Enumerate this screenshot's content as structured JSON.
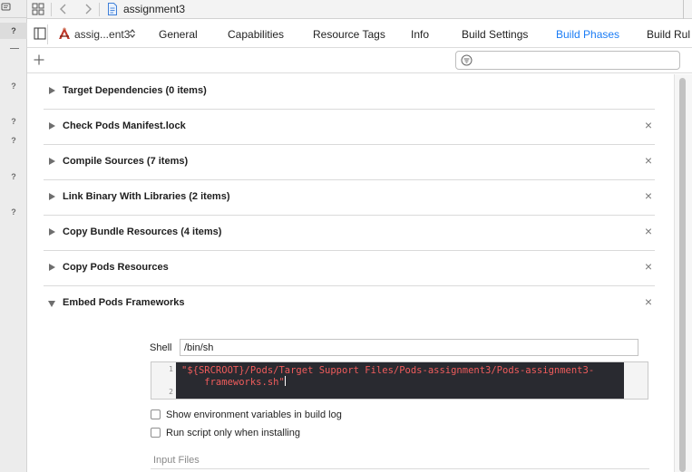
{
  "window": {
    "title": "assignment3"
  },
  "gutter": {
    "markers": [
      "?",
      "?",
      "?",
      "?",
      "?",
      "?"
    ]
  },
  "tabbar": {
    "target_name": "assig...ent3",
    "tabs": [
      {
        "label": "General",
        "active": false
      },
      {
        "label": "Capabilities",
        "active": false
      },
      {
        "label": "Resource Tags",
        "active": false
      },
      {
        "label": "Info",
        "active": false
      },
      {
        "label": "Build Settings",
        "active": false
      },
      {
        "label": "Build Phases",
        "active": true
      },
      {
        "label": "Build Rul",
        "active": false
      }
    ]
  },
  "filter": {
    "placeholder": ""
  },
  "phases": [
    {
      "label": "Target Dependencies (0 items)",
      "closable": false,
      "expanded": false
    },
    {
      "label": "Check Pods Manifest.lock",
      "closable": true,
      "expanded": false
    },
    {
      "label": "Compile Sources (7 items)",
      "closable": true,
      "expanded": false
    },
    {
      "label": "Link Binary With Libraries (2 items)",
      "closable": true,
      "expanded": false
    },
    {
      "label": "Copy Bundle Resources (4 items)",
      "closable": true,
      "expanded": false
    },
    {
      "label": "Copy Pods Resources",
      "closable": true,
      "expanded": false
    },
    {
      "label": "Embed Pods Frameworks",
      "closable": true,
      "expanded": true
    }
  ],
  "close_symbol": "×",
  "script_phase": {
    "shell_label": "Shell",
    "shell_value": "/bin/sh",
    "line_numbers": [
      "1",
      "2"
    ],
    "code_line_1": "\"${SRCROOT}/Pods/Target Support Files/Pods-assignment3/Pods-assignment3-",
    "code_line_2": "    frameworks.sh\"",
    "show_env_label": "Show environment variables in build log",
    "run_only_installing_label": "Run script only when installing",
    "input_files_label": "Input Files"
  },
  "colors": {
    "accent": "#1a7cf5",
    "code_background": "#292a30",
    "code_string": "#f05c5c"
  },
  "icons": {
    "related": "grid-icon",
    "back": "chevron-left-icon",
    "forward": "chevron-right-icon",
    "file": "file-icon",
    "sidebar": "sidebar-toggle-icon",
    "target": "app-target-icon",
    "add": "plus-icon",
    "filter": "filter-icon"
  }
}
